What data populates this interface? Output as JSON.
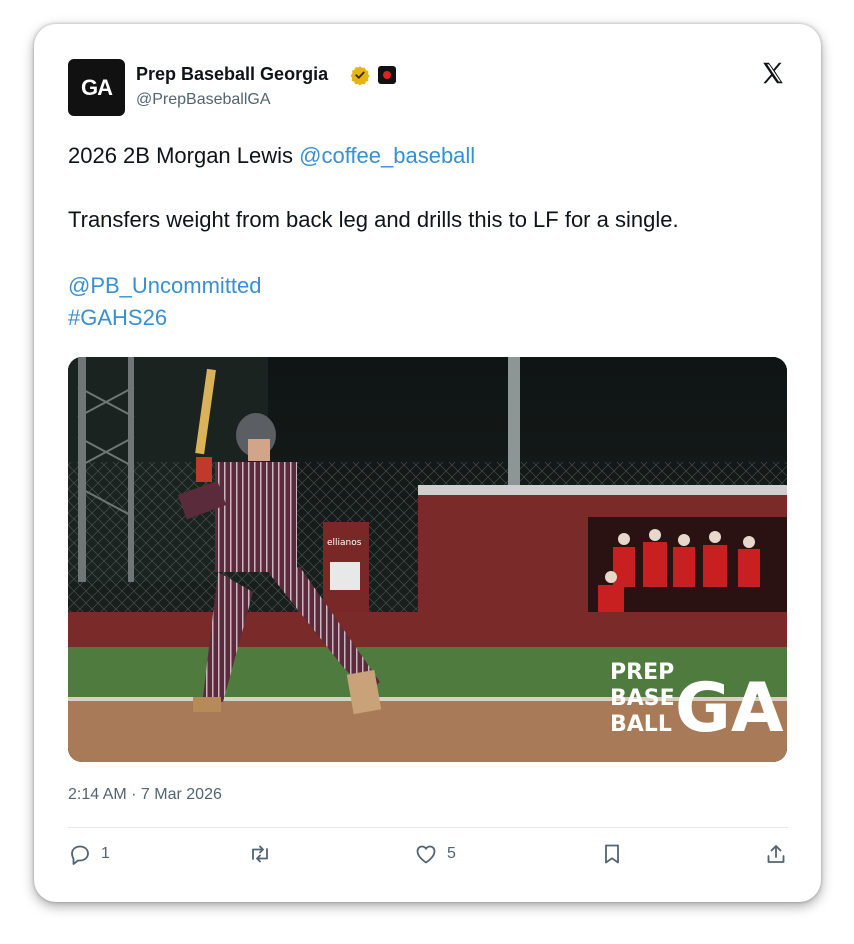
{
  "author": {
    "display_name": "Prep Baseball Georgia",
    "handle": "@PrepBaseballGA",
    "avatar_text": "GA",
    "verified_icon": "verified-gold-badge-icon",
    "affiliate_icon": "affiliate-badge-icon"
  },
  "platform": {
    "logo_icon": "x-logo-icon"
  },
  "tweet": {
    "line1_text": "2026 2B Morgan Lewis ",
    "line1_mention": "@coffee_baseball",
    "line2_text": "Transfers weight from back leg and drills this to LF for a single.",
    "mention2": "@PB_Uncommitted",
    "hashtag": "#GAHS26"
  },
  "media": {
    "alt": "Batter in maroon pinstripe uniform in batting stance at night game",
    "watermark_lines": [
      "PREP",
      "BASE",
      "BALL"
    ],
    "watermark_logo": "GA",
    "sign_text": "ellianos"
  },
  "meta": {
    "timestamp": "2:14 AM · 7 Mar 2026"
  },
  "actions": {
    "reply_count": "1",
    "retweet_count": "",
    "like_count": "5",
    "icons": [
      "reply-icon",
      "retweet-icon",
      "like-icon",
      "bookmark-icon",
      "share-icon"
    ]
  },
  "colors": {
    "link": "#3a8fd0",
    "text": "#0f1419",
    "secondary": "#536471",
    "verified": "#e7b416"
  }
}
